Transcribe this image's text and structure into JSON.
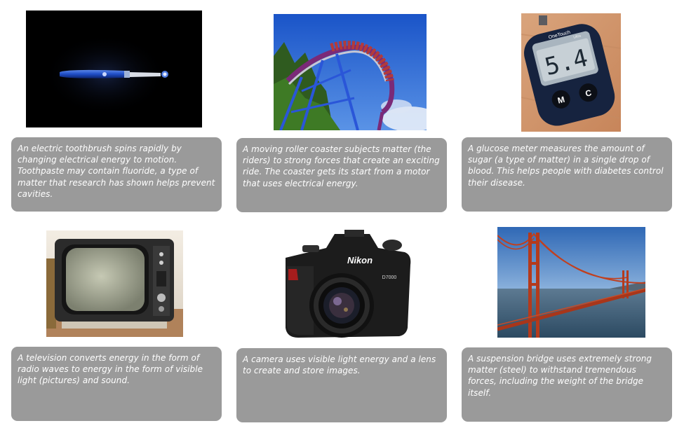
{
  "cards": [
    {
      "image_subject": "electric-toothbrush",
      "caption": "An electric toothbrush spins rapidly by changing electrical energy to motion. Toothpaste may contain fluoride, a type of matter that research has shown helps prevent cavities."
    },
    {
      "image_subject": "roller-coaster",
      "caption": "A moving roller coaster subjects matter (the riders) to strong forces that create an exciting ride. The coaster gets its start from a motor that uses electrical energy."
    },
    {
      "image_subject": "glucose-meter",
      "caption": "A glucose meter measures the amount of sugar (a type of matter) in a single drop of blood. This helps people with diabetes control their disease.",
      "device_brand": "OneTouch",
      "device_model": "Ultra",
      "reading": "5.4",
      "button_m": "M",
      "button_c": "C"
    },
    {
      "image_subject": "television",
      "caption": "A television converts energy in the form of radio waves to energy in the form of visible light (pictures) and sound."
    },
    {
      "image_subject": "camera",
      "caption": "A camera uses visible light energy and a lens to create and store images.",
      "camera_brand": "Nikon",
      "camera_model": "D7000"
    },
    {
      "image_subject": "suspension-bridge",
      "caption": "A suspension bridge uses extremely strong matter (steel) to withstand tremendous forces, including the weight of the bridge itself."
    }
  ]
}
